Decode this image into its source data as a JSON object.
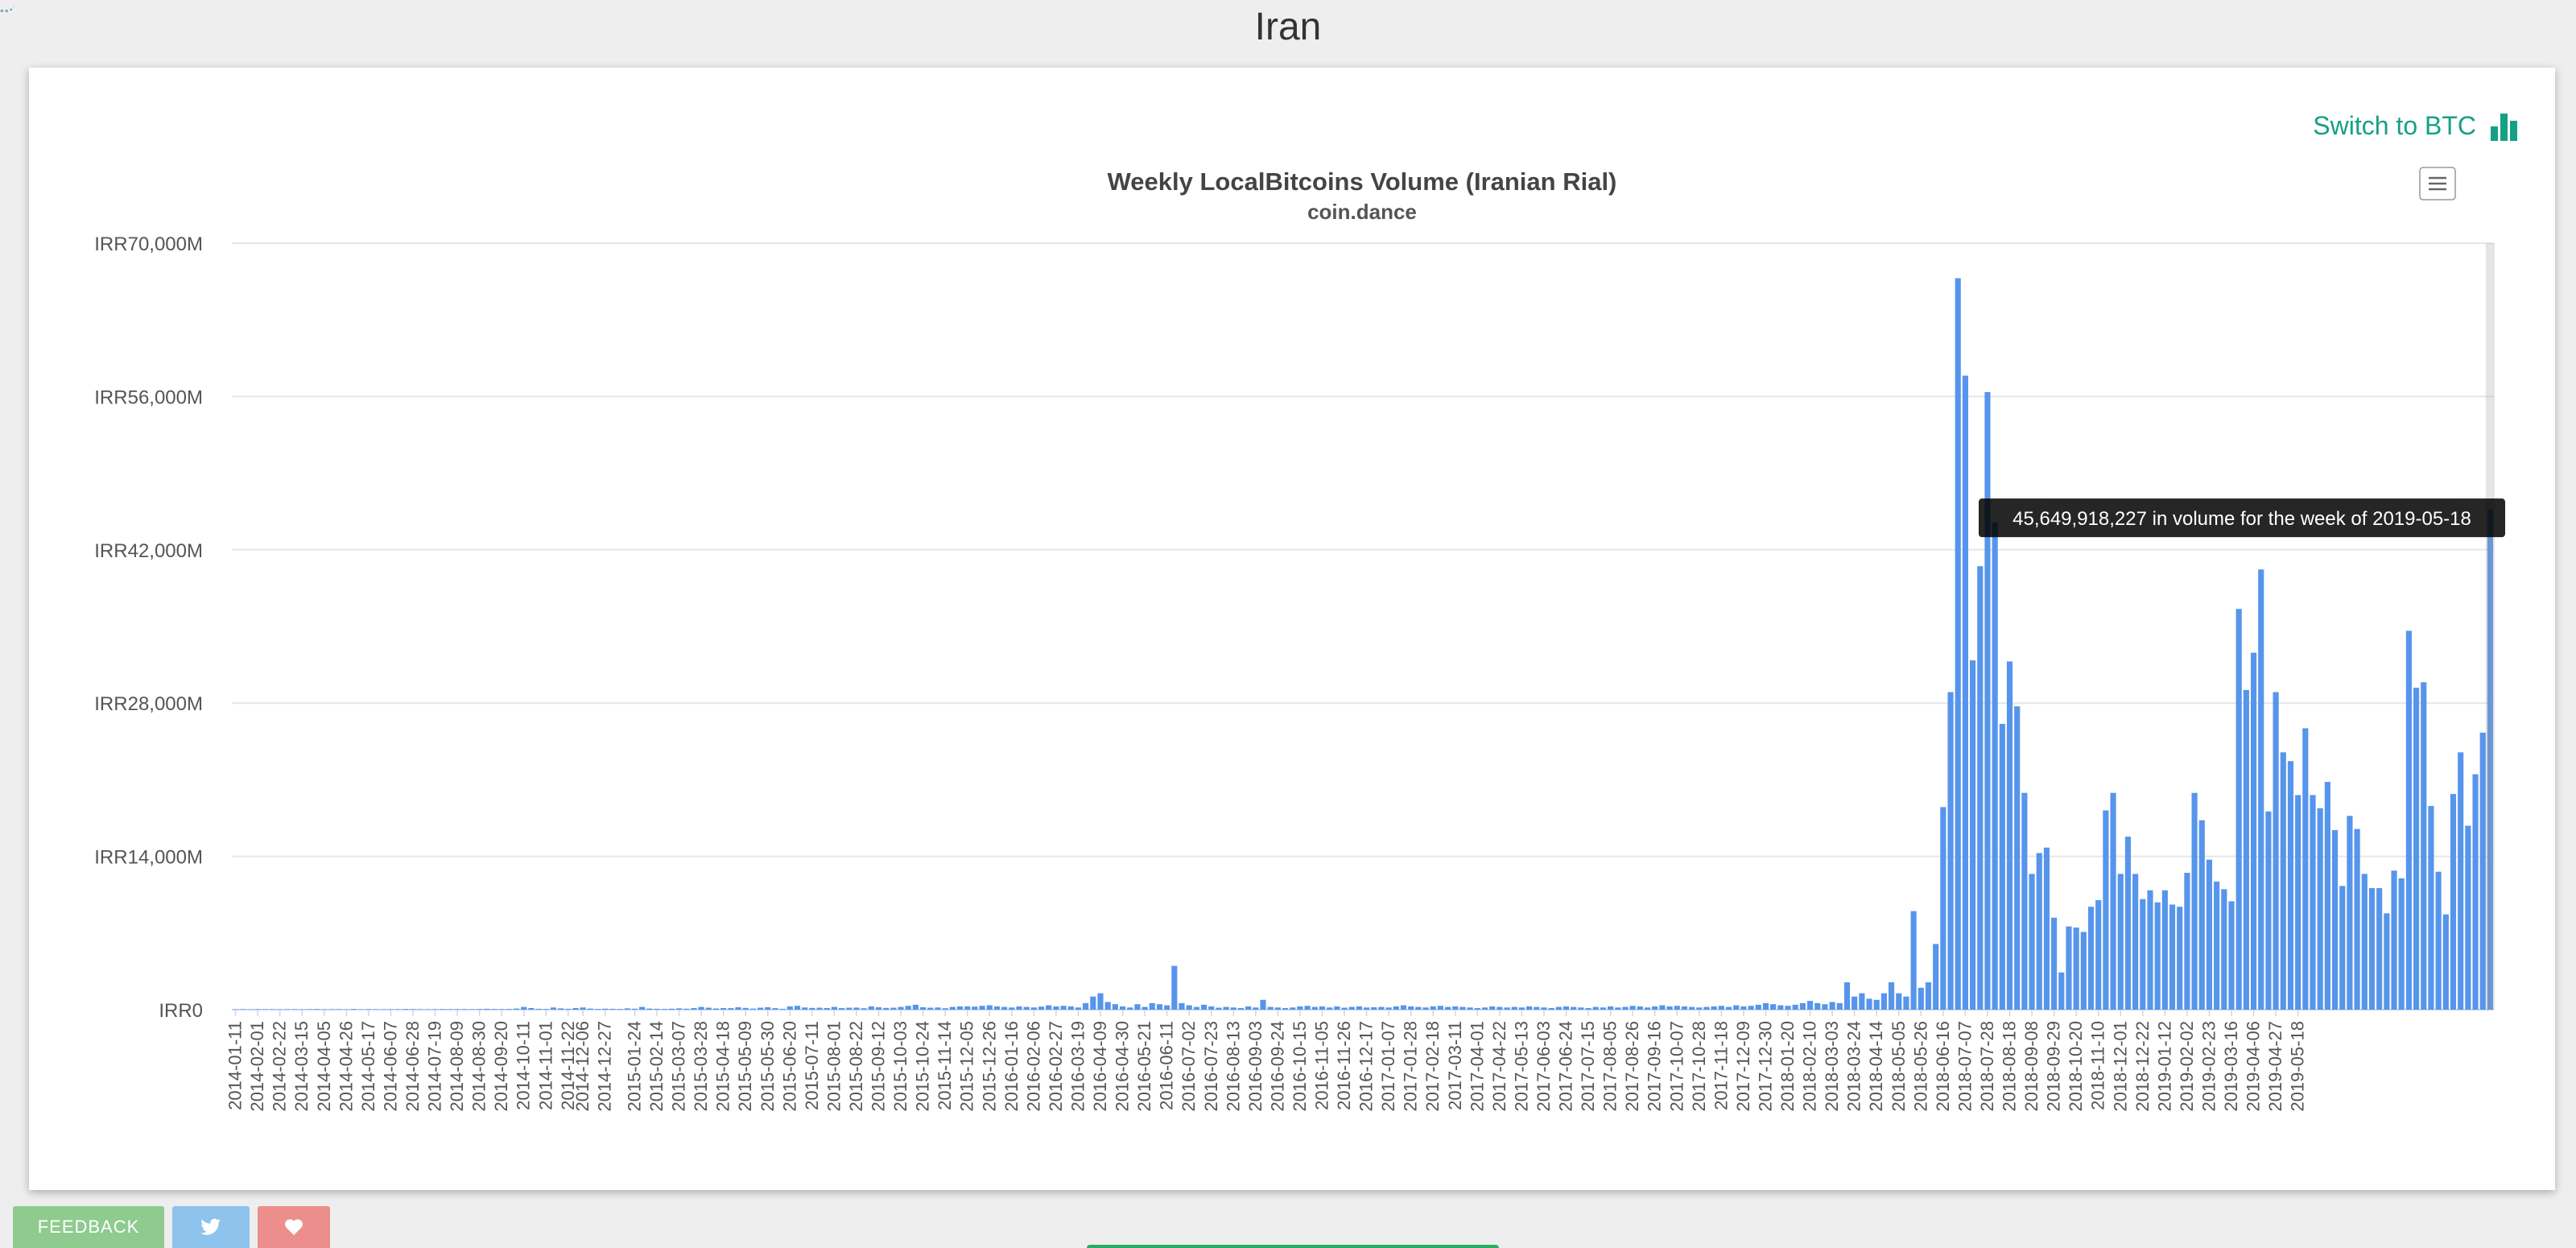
{
  "page": {
    "title": "Iran"
  },
  "toolbar": {
    "switch_label": "Switch to BTC",
    "switch_icon": "bar-chart-icon",
    "menu_icon": "hamburger-menu-icon"
  },
  "footer": {
    "feedback_label": "FEEDBACK",
    "twitter_icon": "twitter-bird-icon",
    "heart_icon": "heart-icon"
  },
  "colors": {
    "bar": "#5795ec",
    "accent": "#16a085",
    "feedback": "#8fcb8e",
    "twitter": "#8dc3ec",
    "heart": "#ec8f8c"
  },
  "chart_data": {
    "type": "bar",
    "title": "Weekly LocalBitcoins Volume (Iranian Rial)",
    "subtitle": "coin.dance",
    "xlabel": "",
    "ylabel": "",
    "ylim": [
      0,
      70000
    ],
    "y_unit": "millions of IRR",
    "yticks": [
      0,
      14000,
      28000,
      42000,
      56000,
      70000
    ],
    "ytick_labels": [
      "IRR0",
      "IRR14,000M",
      "IRR28,000M",
      "IRR42,000M",
      "IRR56,000M",
      "IRR70,000M"
    ],
    "grid": true,
    "legend": false,
    "x_start": "2014-01-11",
    "x_step_days": 7,
    "x_tick_labels": [
      "2014-01-11",
      "2014-02-01",
      "2014-02-22",
      "2014-03-15",
      "2014-04-05",
      "2014-04-26",
      "2014-05-17",
      "2014-06-07",
      "2014-06-28",
      "2014-07-19",
      "2014-08-09",
      "2014-08-30",
      "2014-09-20",
      "2014-10-11",
      "2014-11-01",
      "2014-11-22",
      "2014-12-06",
      "2014-12-27",
      "2015-01-24",
      "2015-02-14",
      "2015-03-07",
      "2015-03-28",
      "2015-04-18",
      "2015-05-09",
      "2015-05-30",
      "2015-06-20",
      "2015-07-11",
      "2015-08-01",
      "2015-08-22",
      "2015-09-12",
      "2015-10-03",
      "2015-10-24",
      "2015-11-14",
      "2015-12-05",
      "2015-12-26",
      "2016-01-16",
      "2016-02-06",
      "2016-02-27",
      "2016-03-19",
      "2016-04-09",
      "2016-04-30",
      "2016-05-21",
      "2016-06-11",
      "2016-07-02",
      "2016-07-23",
      "2016-08-13",
      "2016-09-03",
      "2016-09-24",
      "2016-10-15",
      "2016-11-05",
      "2016-11-26",
      "2016-12-17",
      "2017-01-07",
      "2017-01-28",
      "2017-02-18",
      "2017-03-11",
      "2017-04-01",
      "2017-04-22",
      "2017-05-13",
      "2017-06-03",
      "2017-06-24",
      "2017-07-15",
      "2017-08-05",
      "2017-08-26",
      "2017-09-16",
      "2017-10-07",
      "2017-10-28",
      "2017-11-18",
      "2017-12-09",
      "2017-12-30",
      "2018-01-20",
      "2018-02-10",
      "2018-03-03",
      "2018-03-24",
      "2018-04-14",
      "2018-05-05",
      "2018-05-26",
      "2018-06-16",
      "2018-07-07",
      "2018-07-28",
      "2018-08-18",
      "2018-09-08",
      "2018-09-29",
      "2018-10-20",
      "2018-11-10",
      "2018-12-01",
      "2018-12-22",
      "2019-01-12",
      "2019-02-02",
      "2019-02-23",
      "2019-03-16",
      "2019-04-06",
      "2019-04-27",
      "2019-05-18"
    ],
    "values": [
      30,
      40,
      30,
      50,
      40,
      40,
      30,
      40,
      40,
      30,
      40,
      50,
      30,
      40,
      40,
      30,
      60,
      30,
      50,
      40,
      30,
      40,
      40,
      60,
      50,
      40,
      30,
      40,
      50,
      40,
      50,
      50,
      40,
      60,
      80,
      60,
      50,
      60,
      100,
      250,
      150,
      80,
      60,
      200,
      120,
      80,
      150,
      200,
      100,
      60,
      90,
      80,
      60,
      120,
      90,
      250,
      100,
      80,
      60,
      90,
      120,
      90,
      150,
      250,
      180,
      110,
      150,
      140,
      220,
      160,
      100,
      180,
      220,
      140,
      80,
      300,
      350,
      200,
      160,
      180,
      150,
      250,
      150,
      180,
      190,
      130,
      300,
      220,
      160,
      180,
      250,
      350,
      450,
      220,
      180,
      200,
      130,
      250,
      300,
      300,
      280,
      350,
      400,
      300,
      250,
      200,
      300,
      250,
      200,
      280,
      400,
      300,
      350,
      300,
      200,
      600,
      1200,
      1500,
      700,
      500,
      300,
      200,
      500,
      250,
      600,
      500,
      400,
      4000,
      600,
      400,
      250,
      450,
      300,
      180,
      250,
      200,
      150,
      300,
      200,
      900,
      250,
      200,
      150,
      200,
      300,
      350,
      250,
      300,
      200,
      300,
      180,
      250,
      300,
      200,
      220,
      250,
      200,
      300,
      400,
      300,
      250,
      200,
      300,
      350,
      250,
      300,
      250,
      200,
      150,
      200,
      300,
      250,
      200,
      250,
      200,
      300,
      250,
      200,
      150,
      250,
      300,
      250,
      200,
      150,
      250,
      200,
      300,
      200,
      250,
      350,
      300,
      200,
      300,
      400,
      300,
      350,
      300,
      250,
      200,
      250,
      300,
      350,
      250,
      400,
      300,
      350,
      450,
      600,
      500,
      400,
      350,
      450,
      600,
      800,
      600,
      500,
      700,
      600,
      2500,
      1200,
      1500,
      1000,
      900,
      1500,
      2500,
      1500,
      1200,
      9000,
      2000,
      2500,
      6000,
      18500,
      29000,
      66800,
      57900,
      31900,
      40500,
      56400,
      44500,
      26100,
      31800,
      27700,
      19800,
      12400,
      14300,
      14800,
      8400,
      3400,
      7600,
      7500,
      7100,
      9400,
      10000,
      18200,
      19800,
      12400,
      15800,
      12400,
      10100,
      10900,
      9800,
      10900,
      9600,
      9400,
      12500,
      19800,
      17300,
      13700,
      11700,
      11000,
      9900,
      36600,
      29200,
      32600,
      40200,
      18100,
      29000,
      23500,
      22700,
      19600,
      25700,
      19600,
      18400,
      20800,
      16400,
      11300,
      17700,
      16500,
      12400,
      11100,
      11100,
      8800,
      12700,
      12000,
      34600,
      29400,
      29900,
      18600,
      12600,
      8700,
      19700,
      23500,
      16800,
      21500,
      25300,
      45650
    ]
  },
  "tooltip": {
    "text": "45,649,918,227 in volume for the week of 2019-05-18"
  }
}
